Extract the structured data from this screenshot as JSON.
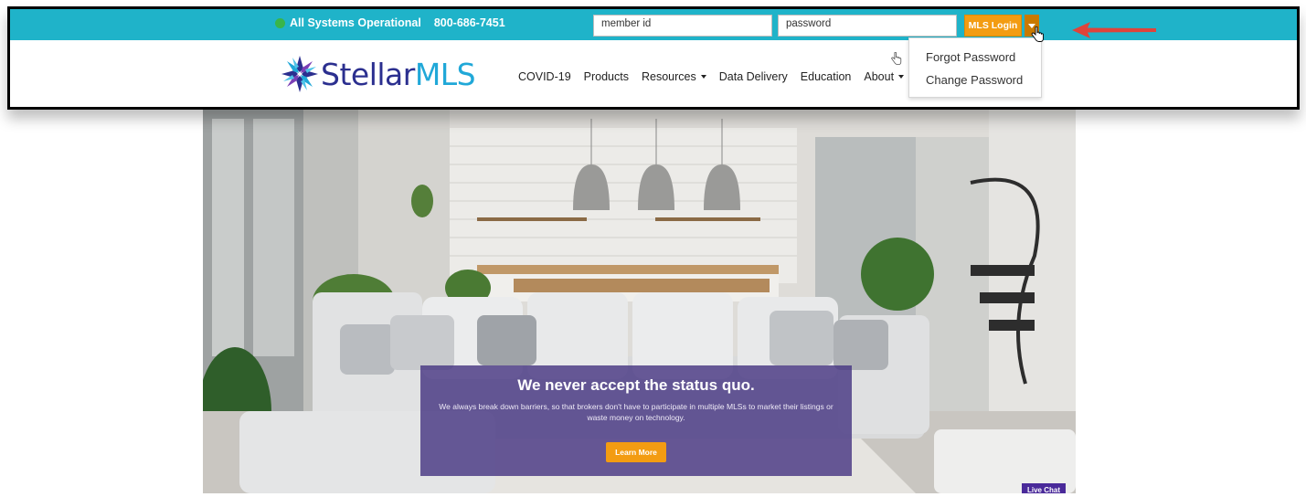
{
  "topbar": {
    "status_text": "All Systems Operational",
    "phone": "800-686-7451",
    "member_placeholder": "member id",
    "password_placeholder": "password",
    "login_label": "MLS Login"
  },
  "brand": {
    "logo_text_primary": "Stellar",
    "logo_text_secondary": "MLS",
    "primary_color": "#2b2f8f",
    "accent_color": "#20a8d8"
  },
  "nav": {
    "items": [
      {
        "label": "COVID-19",
        "has_dropdown": false
      },
      {
        "label": "Products",
        "has_dropdown": false
      },
      {
        "label": "Resources",
        "has_dropdown": true
      },
      {
        "label": "Data Delivery",
        "has_dropdown": false
      },
      {
        "label": "Education",
        "has_dropdown": false
      },
      {
        "label": "About",
        "has_dropdown": true
      }
    ]
  },
  "login_dropdown": {
    "items": [
      "Forgot Password",
      "Change Password"
    ]
  },
  "hero": {
    "title": "We never accept the status quo.",
    "body": "We always break down barriers, so that brokers don't have to participate in multiple MLSs to market their listings or waste money on technology.",
    "cta_label": "Learn More"
  },
  "live_chat": {
    "label": "Live Chat"
  },
  "colors": {
    "topbar": "#1fb3c9",
    "login_button": "#f39c12",
    "overlay": "#48378a",
    "annotation_arrow": "#e0433a"
  },
  "icons": {
    "status": "green-dot-icon",
    "caret": "caret-down-icon",
    "cursor": "hand-cursor-icon",
    "annotation": "red-arrow-icon"
  }
}
